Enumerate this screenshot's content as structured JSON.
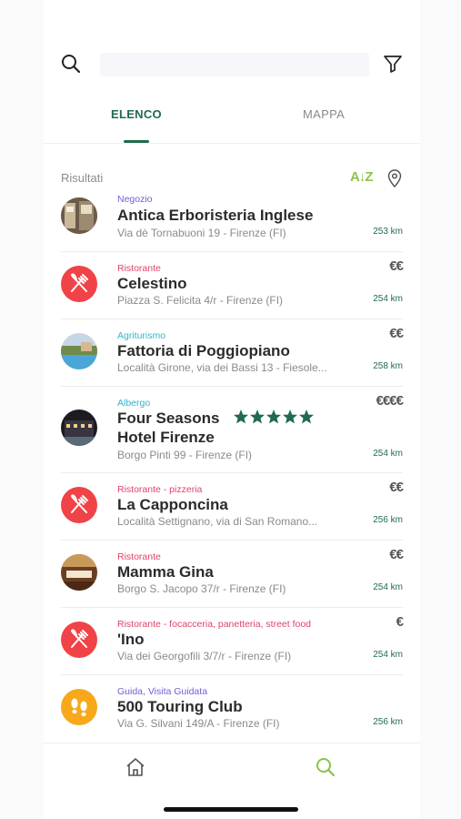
{
  "search": {
    "placeholder": "",
    "value": ""
  },
  "tabs": [
    {
      "label": "ELENCO",
      "active": true
    },
    {
      "label": "MAPPA",
      "active": false
    }
  ],
  "results": {
    "label": "Risultati",
    "sort_label": "A↓Z"
  },
  "colors": {
    "accent": "#1f6b4c",
    "sort": "#8bc34a",
    "restaurant": "#f04347",
    "guide": "#f7a81b"
  },
  "items": [
    {
      "category": "Negozio",
      "category_color": "#6f5fd6",
      "name": "Antica Erboristeria Inglese",
      "address": "Via dè Tornabuoni 19 - Firenze (FI)",
      "distance": "253 km",
      "price": "",
      "avatar": "photo-shop"
    },
    {
      "category": "Ristorante",
      "category_color": "#e0426a",
      "name": "Celestino",
      "address": "Piazza S. Felicita 4/r - Firenze (FI)",
      "distance": "254 km",
      "price": "€€",
      "avatar": "fork-knife-icon"
    },
    {
      "category": "Agriturismo",
      "category_color": "#35b3c9",
      "name": "Fattoria di Poggiopiano",
      "address": "Località Girone, via dei Bassi 13 - Fiesole...",
      "distance": "258 km",
      "price": "€€",
      "avatar": "photo-pool"
    },
    {
      "category": "Albergo",
      "category_color": "#35b3c9",
      "name_line1": "Four Seasons",
      "name_line2": "Hotel Firenze",
      "rating": 5,
      "address": "Borgo Pinti 99 - Firenze (FI)",
      "distance": "254 km",
      "price": "€€€€",
      "avatar": "photo-hotel"
    },
    {
      "category": "Ristorante - pizzeria",
      "category_color": "#e0426a",
      "name": "La Capponcina",
      "address": "Località Settignano, via di San Romano...",
      "distance": "256 km",
      "price": "€€",
      "avatar": "fork-knife-icon"
    },
    {
      "category": "Ristorante",
      "category_color": "#e0426a",
      "name": "Mamma Gina",
      "address": "Borgo S. Jacopo 37/r - Firenze (FI)",
      "distance": "254 km",
      "price": "€€",
      "avatar": "photo-restaurant"
    },
    {
      "category": "Ristorante - focacceria, panetteria, street food",
      "category_color": "#e0426a",
      "name": "'Ino",
      "address": "Via dei Georgofili 3/7/r - Firenze (FI)",
      "distance": "254 km",
      "price": "€",
      "avatar": "fork-knife-icon"
    },
    {
      "category": "Guida, Visita Guidata",
      "category_color": "#6f5fd6",
      "name": "500 Touring Club",
      "address": "Via G. Silvani 149/A - Firenze (FI)",
      "distance": "256 km",
      "price": "",
      "avatar": "footprints-icon"
    }
  ],
  "bottom_nav": [
    {
      "icon": "home-icon",
      "active": false
    },
    {
      "icon": "search-icon",
      "active": true
    }
  ]
}
